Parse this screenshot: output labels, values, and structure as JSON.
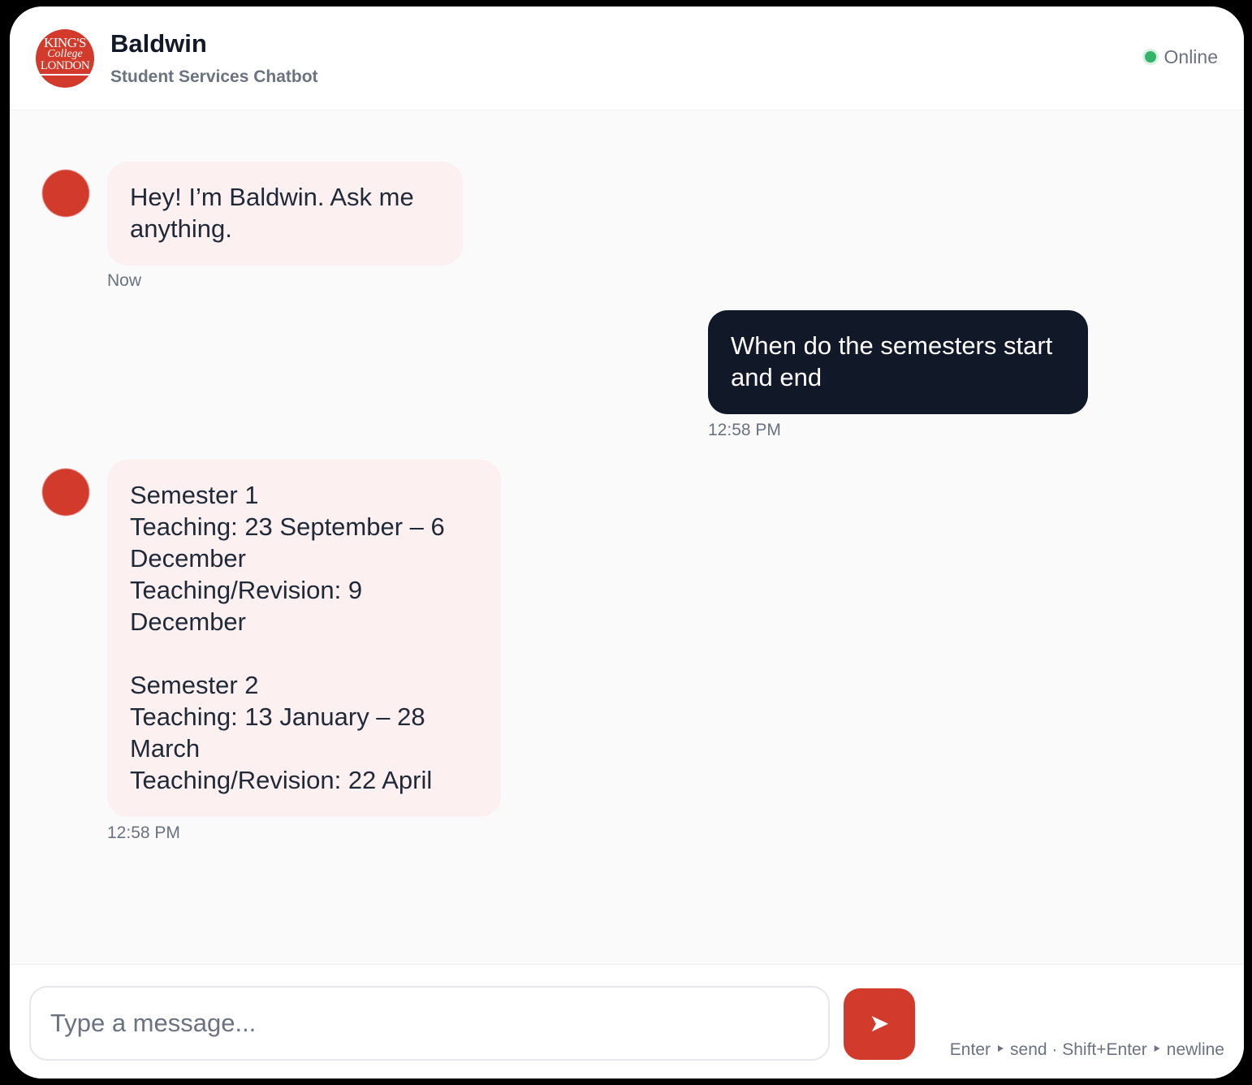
{
  "header": {
    "logo_text": [
      "KING'S",
      "College",
      "LONDON"
    ],
    "title": "Baldwin",
    "subtitle": "Student Services Chatbot",
    "status": "Online",
    "status_color": "#34b36a"
  },
  "messages": [
    {
      "sender": "bot",
      "text": "Hey! I’m Baldwin. Ask me anything.",
      "time": "Now"
    },
    {
      "sender": "user",
      "text": "When do the semesters start and end",
      "time": "12:58 PM"
    },
    {
      "sender": "bot",
      "text": "Semester 1\nTeaching: 23 September – 6 December\nTeaching/Revision: 9 December\n\nSemester 2\nTeaching: 13 January – 28 March\nTeaching/Revision: 22 April",
      "time": "12:58 PM"
    }
  ],
  "composer": {
    "placeholder": "Type a message...",
    "value": "",
    "send_icon": "send-arrow-icon",
    "hint": "Enter ‣ send · Shift+Enter ‣ newline"
  },
  "colors": {
    "brand": "#d23a2c",
    "user_bubble": "#111827",
    "bot_bubble": "#fcf0f0"
  }
}
